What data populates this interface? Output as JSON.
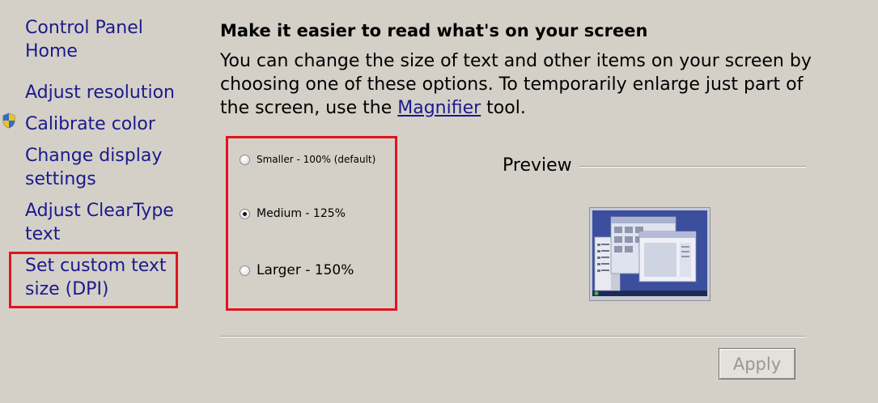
{
  "nav": {
    "home": "Control Panel Home",
    "adjust_resolution": "Adjust resolution",
    "calibrate_color": "Calibrate color",
    "change_display": "Change display settings",
    "adjust_cleartype": "Adjust ClearType text",
    "custom_dpi": "Set custom text size (DPI)"
  },
  "main": {
    "heading": "Make it easier to read what's on your screen",
    "description_before": "You can change the size of text and other items on your screen by choosing one of these options. To temporarily enlarge just part of the screen, use the ",
    "magnifier_link": "Magnifier",
    "description_after": " tool."
  },
  "options": [
    {
      "label": "Smaller - 100% (default)",
      "selected": false
    },
    {
      "label": "Medium - 125%",
      "selected": true
    },
    {
      "label": "Larger - 150%",
      "selected": false
    }
  ],
  "preview": {
    "label": "Preview"
  },
  "apply_button": {
    "label": "Apply",
    "enabled": false
  },
  "colors": {
    "background": "#d4d0c8",
    "link": "#1a1a8c",
    "highlight": "#e0141c"
  },
  "icons": {
    "calibrate": "uac-shield-icon"
  }
}
